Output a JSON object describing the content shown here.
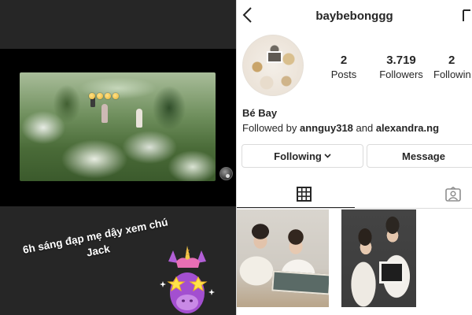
{
  "story": {
    "caption": "6h sáng đạp mẹ dậy xem chú Jack"
  },
  "profile": {
    "username": "baybebonggg",
    "stats": [
      {
        "value": "2",
        "label": "Posts"
      },
      {
        "value": "3.719",
        "label": "Followers"
      },
      {
        "value": "2",
        "label": "Followin"
      }
    ],
    "display_name": "Bé Bay",
    "followed_by_prefix": "Followed by ",
    "followed_by_user1": "annguy318",
    "followed_by_and": " and ",
    "followed_by_user2": "alexandra.ng",
    "buttons": {
      "following": "Following",
      "message": "Message"
    },
    "tabs": [
      {
        "icon": "grid-icon",
        "active": true
      },
      {
        "icon": "tagged-icon",
        "active": false
      }
    ]
  },
  "colors": {
    "story_bg": "#262626",
    "text_primary": "#262626",
    "border": "#dbdbdb"
  }
}
